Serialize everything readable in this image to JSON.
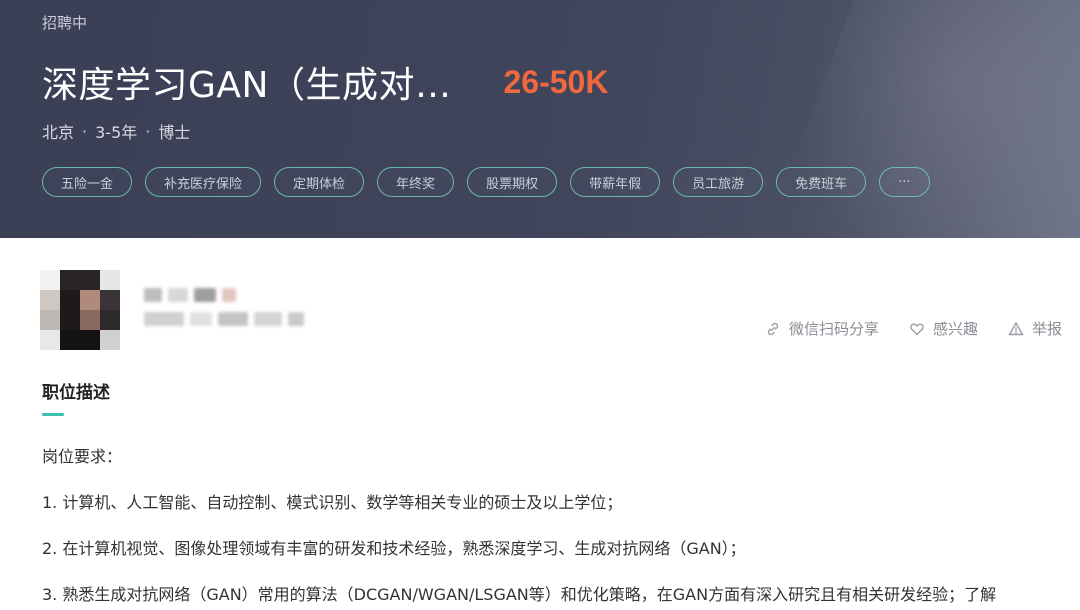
{
  "header": {
    "status": "招聘中",
    "job_title": "深度学习GAN（生成对…",
    "salary": "26-50K",
    "meta": {
      "city": "北京",
      "experience": "3-5年",
      "education": "博士",
      "separator": "·"
    },
    "tags": [
      "五险一金",
      "补充医疗保险",
      "定期体检",
      "年终奖",
      "股票期权",
      "带薪年假",
      "员工旅游",
      "免费班车",
      "···"
    ]
  },
  "poster": {
    "avatar_icon": "avatar-blurred"
  },
  "actions": {
    "share": {
      "label": "微信扫码分享",
      "icon": "link-icon"
    },
    "interest": {
      "label": "感兴趣",
      "icon": "heart-icon"
    },
    "report": {
      "label": "举报",
      "icon": "warning-icon"
    }
  },
  "description": {
    "section_title": "职位描述",
    "lines": [
      "岗位要求：",
      "1. 计算机、人工智能、自动控制、模式识别、数学等相关专业的硕士及以上学位；",
      "2. 在计算机视觉、图像处理领域有丰富的研发和技术经验，熟悉深度学习、生成对抗网络（GAN）；",
      "3. 熟悉生成对抗网络（GAN）常用的算法（DCGAN/WGAN/LSGAN等）和优化策略，在GAN方面有深入研究且有相关研发经验；了解"
    ]
  },
  "colors": {
    "accent": "#3cc0a9",
    "salary": "#f0683e",
    "header_bg": "#3f4459"
  }
}
